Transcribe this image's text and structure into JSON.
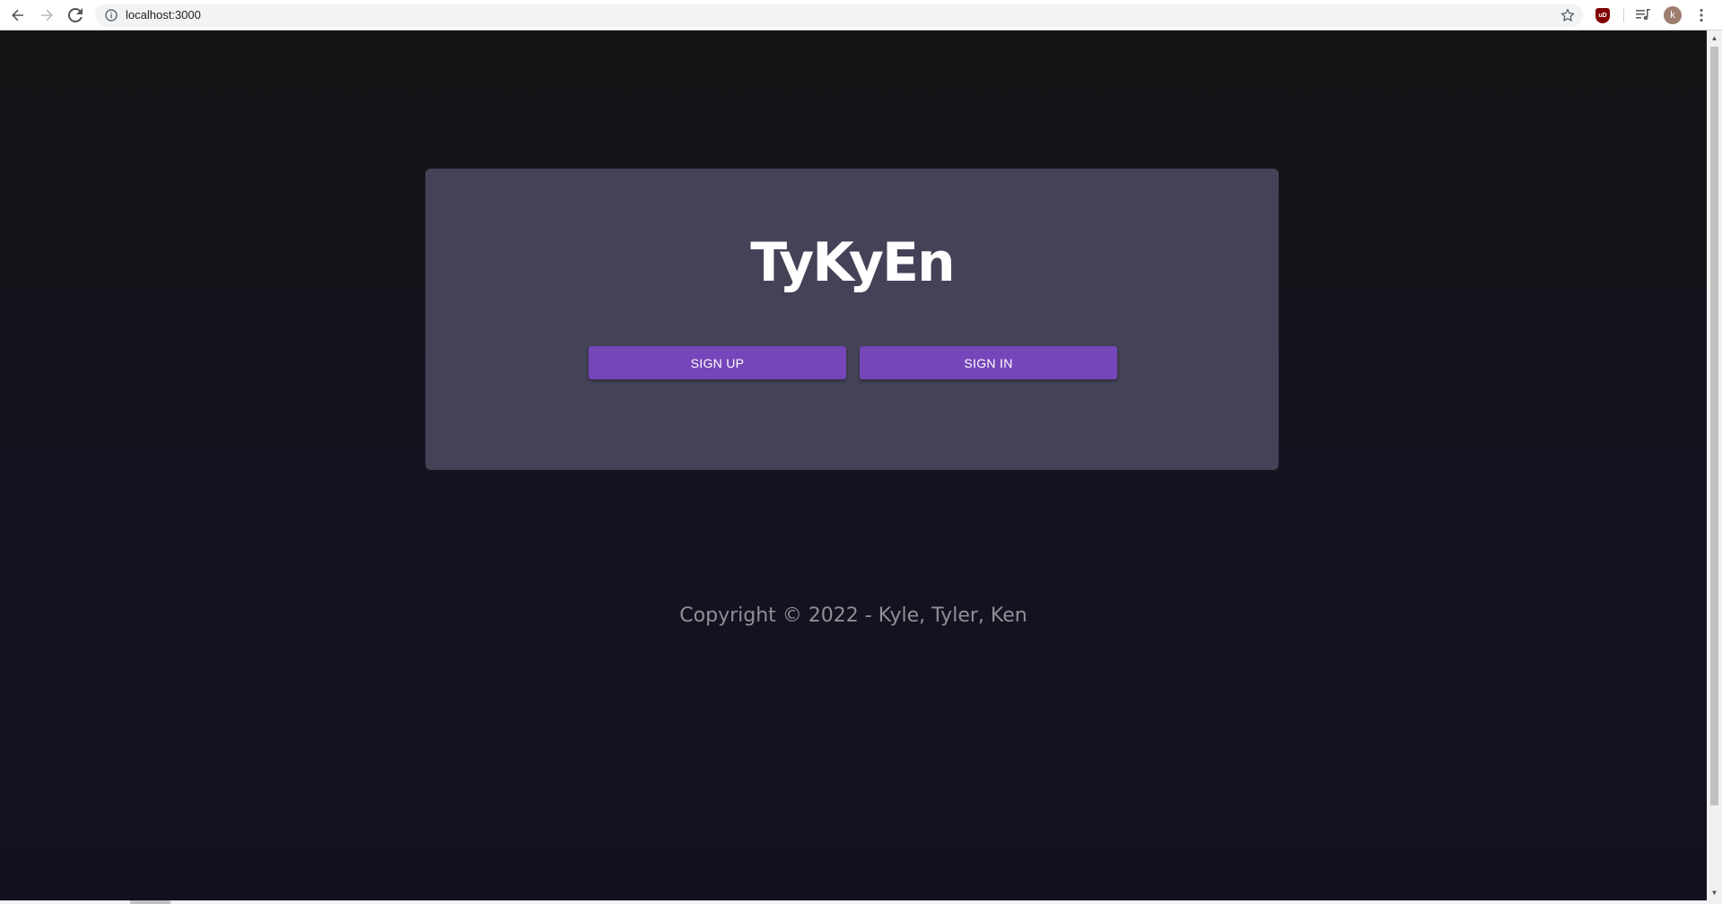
{
  "browser": {
    "url": "localhost:3000",
    "avatar_initial": "k",
    "ublock_badge": "uD"
  },
  "card": {
    "title": "TyKyEn",
    "signup_label": "SIGN UP",
    "signin_label": "SIGN IN"
  },
  "footer": {
    "copyright": "Copyright © 2022 - Kyle, Tyler, Ken"
  },
  "colors": {
    "page_bg": "#141318",
    "card_bg": "#434257",
    "button_bg": "#7546b9",
    "footer_text": "#8f8f96"
  },
  "icons": {
    "back": "arrow-left",
    "forward": "arrow-right",
    "reload": "reload",
    "info": "info-circle",
    "bookmark": "star-outline",
    "media": "media-queue",
    "menu": "vertical-dots"
  }
}
